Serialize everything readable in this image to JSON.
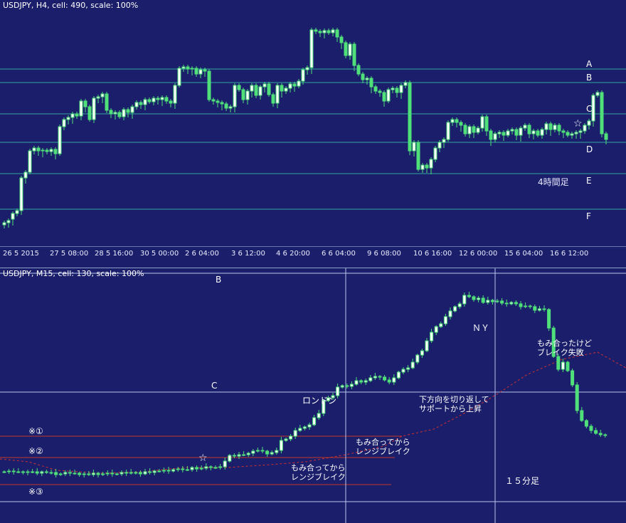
{
  "colors": {
    "background": "#1b1e6a",
    "h4_level": "#2fa6a0",
    "m15_level": "#b9c6ee",
    "range_line": "#c0392b",
    "candle": "#4fe07a",
    "candle_body_bull": "#ffffff",
    "candle_body_bear": "#4fe07a",
    "ma": "#d03030"
  },
  "top": {
    "title": "USDJPY, H4, cell: 490, scale: 100%",
    "timeframe_label": "4時間足"
  },
  "bottom": {
    "title": "USDJPY, M15, cell: 130, scale: 100%",
    "timeframe_label": "１５分足"
  },
  "chart_data": [
    {
      "type": "candlestick",
      "symbol": "USDJPY",
      "timeframe": "H4",
      "x_ticks": [
        "26 5 2015",
        "27 5 08:00",
        "28 5 16:00",
        "30 5 00:00",
        "2 6 04:00",
        "3 6 12:00",
        "4 6 20:00",
        "6 6 04:00",
        "9 6 08:00",
        "10 6 16:00",
        "12 6 00:00",
        "15 6 04:00",
        "16 6 12:00"
      ],
      "level_labels": [
        "A",
        "B",
        "C",
        "D",
        "E",
        "F"
      ],
      "star_marker": "☆"
    },
    {
      "type": "candlestick",
      "symbol": "USDJPY",
      "timeframe": "M15",
      "level_labels": [
        "B",
        "C"
      ],
      "range_labels": [
        "※①",
        "※②",
        "※③"
      ],
      "session_labels": [
        "ロンドン",
        "ＮＹ"
      ],
      "annotations": [
        "もみ合ってから\nレンジブレイク",
        "もみ合ってから\nレンジブレイク",
        "下方向を切り返して\nサポートから上昇",
        "もみ合ったけど\nブレイク失敗"
      ],
      "star_marker": "☆"
    }
  ]
}
